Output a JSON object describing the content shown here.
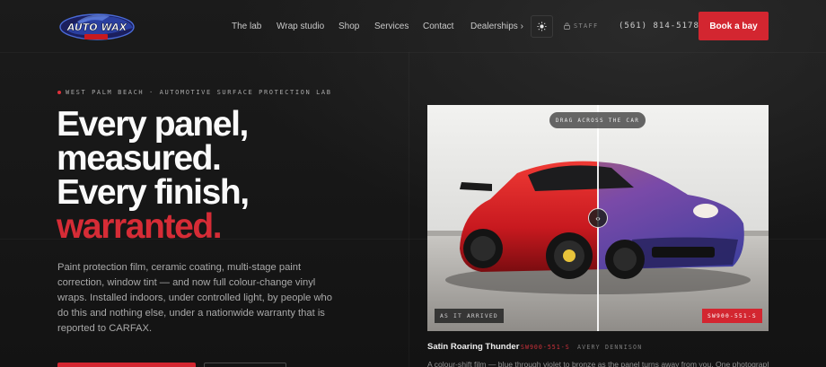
{
  "brand": {
    "logo_text": "AUTO WAX"
  },
  "nav": {
    "items": [
      "The lab",
      "Wrap studio",
      "Shop",
      "Services",
      "Contact",
      "Dealerships ›"
    ],
    "theme_icon": "sun-icon",
    "staff_label": "STAFF",
    "staff_icon": "lock-icon",
    "phone": "(561) 814-5178",
    "book_label": "Book a bay"
  },
  "hero": {
    "eyebrow": "WEST PALM BEACH · AUTOMOTIVE SURFACE PROTECTION LAB",
    "headline_lines": [
      "Every panel,",
      "measured.",
      "Every finish,"
    ],
    "headline_accent": "warranted.",
    "lead": "Paint protection film, ceramic coating, multi-stage paint correction, window tint — and now full colour-change vinyl wraps. Installed indoors, under controlled light, by people who do this and nothing else, under a nationwide warranty that is reported to CARFAX."
  },
  "compare": {
    "hint": "DRAG ACROSS THE CAR",
    "before_label": "AS IT ARRIVED",
    "after_label": "SW900-551-S",
    "handle_icon": "drag-arrows-icon",
    "colors": {
      "before": "#c8191f",
      "after_a": "#3b3f9e",
      "after_b": "#b4656a"
    }
  },
  "caption": {
    "title": "Satin Roaring Thunder",
    "code": "SW900-551-S",
    "brand": "AVERY DENNISON",
    "description": "A colour-shift film — blue through violet to bronze as the panel turns away from you. One photograph,"
  },
  "accent_color": "#d32630"
}
